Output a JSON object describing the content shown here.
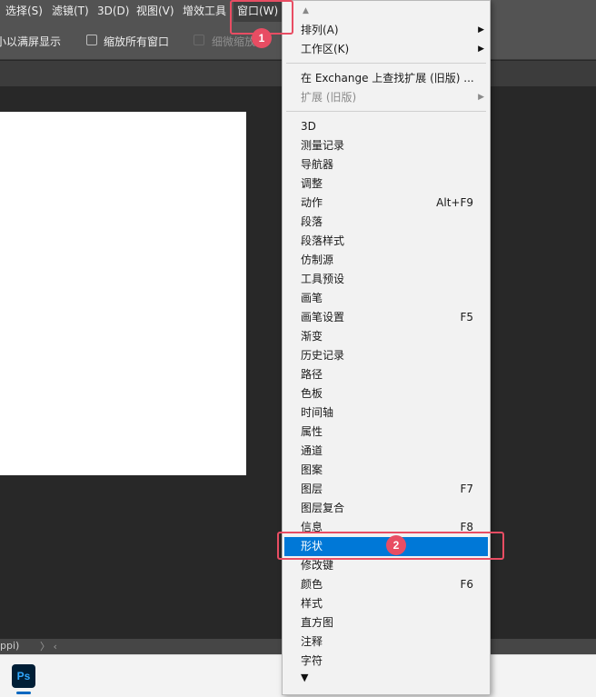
{
  "menubar": {
    "items": [
      "选择(S)",
      "滤镜(T)",
      "3D(D)",
      "视图(V)",
      "增效工具",
      "窗口(W)"
    ]
  },
  "options": {
    "fit_screen": "小以满屏显示",
    "zoom_all": "缩放所有窗口",
    "scrubby_zoom": "细微缩放"
  },
  "status": {
    "text": "ppi)",
    "chevron": "〉 ‹"
  },
  "taskbar": {
    "ps_label": "Ps"
  },
  "dropdown": {
    "scroll_up": "▲",
    "scroll_down": "▼",
    "group1": [
      {
        "label": "排列(A)",
        "submenu": "▶"
      },
      {
        "label": "工作区(K)",
        "submenu": "▶"
      }
    ],
    "group2": [
      {
        "label": "在 Exchange 上查找扩展 (旧版) ..."
      },
      {
        "label": "扩展 (旧版)",
        "submenu": "▶"
      }
    ],
    "panels": [
      {
        "label": "3D",
        "shortcut": ""
      },
      {
        "label": "测量记录",
        "shortcut": ""
      },
      {
        "label": "导航器",
        "shortcut": ""
      },
      {
        "label": "调整",
        "shortcut": ""
      },
      {
        "label": "动作",
        "shortcut": "Alt+F9"
      },
      {
        "label": "段落",
        "shortcut": ""
      },
      {
        "label": "段落样式",
        "shortcut": ""
      },
      {
        "label": "仿制源",
        "shortcut": ""
      },
      {
        "label": "工具预设",
        "shortcut": ""
      },
      {
        "label": "画笔",
        "shortcut": ""
      },
      {
        "label": "画笔设置",
        "shortcut": "F5"
      },
      {
        "label": "渐变",
        "shortcut": ""
      },
      {
        "label": "历史记录",
        "shortcut": ""
      },
      {
        "label": "路径",
        "shortcut": ""
      },
      {
        "label": "色板",
        "shortcut": ""
      },
      {
        "label": "时间轴",
        "shortcut": ""
      },
      {
        "label": "属性",
        "shortcut": ""
      },
      {
        "label": "通道",
        "shortcut": ""
      },
      {
        "label": "图案",
        "shortcut": ""
      },
      {
        "label": "图层",
        "shortcut": "F7"
      },
      {
        "label": "图层复合",
        "shortcut": ""
      },
      {
        "label": "信息",
        "shortcut": "F8"
      },
      {
        "label": "形状",
        "shortcut": ""
      },
      {
        "label": "修改键",
        "shortcut": ""
      },
      {
        "label": "颜色",
        "shortcut": "F6"
      },
      {
        "label": "样式",
        "shortcut": ""
      },
      {
        "label": "直方图",
        "shortcut": ""
      },
      {
        "label": "注释",
        "shortcut": ""
      },
      {
        "label": "字符",
        "shortcut": ""
      }
    ]
  },
  "annotations": {
    "badge1": "1",
    "badge2": "2"
  },
  "colors": {
    "selected": "#0078d7",
    "annotation": "#e84d63"
  }
}
